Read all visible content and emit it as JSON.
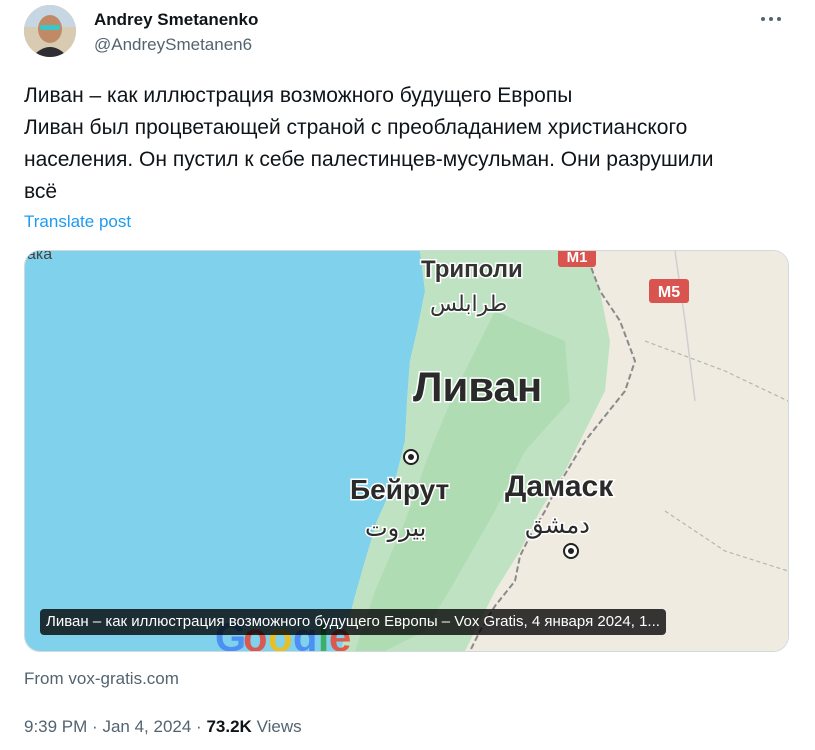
{
  "tweet": {
    "author_name": "Andrey Smetanenko",
    "author_handle": "@AndreySmetanen6",
    "text_lines": [
      "Ливан – как иллюстрация возможного будущего Европы",
      "Ливан был процветающей страной с преобладанием христианского",
      "населения. Он пустил к себе палестинцев-мусульман. Они разрушили",
      "всё"
    ],
    "translate_label": "Translate post",
    "link_source": "From vox-gratis.com",
    "time": "9:39 PM",
    "separator": "·",
    "date": "Jan 4, 2024",
    "views_count": "73.2K",
    "views_label": "Views"
  },
  "card": {
    "caption": "Ливан – как иллюстрация возможного будущего Европы – Vox Gratis, 4 января 2024, 1..."
  },
  "map": {
    "labels": {
      "tripoli": "Триполи",
      "tripoli_ar": "طرابلس",
      "lebanon": "Ливан",
      "beirut": "Бейрут",
      "beirut_ar": "بيروت",
      "damascus": "Дамаск",
      "damascus_ar": "دمشق",
      "road_m1": "M1",
      "road_m5": "M5",
      "top_left_fragment": "ака"
    },
    "colors": {
      "sea": "#7fd1ec",
      "land": "#efebe1",
      "green": "#bfe3c2",
      "road_shield": "#d9534f"
    }
  }
}
